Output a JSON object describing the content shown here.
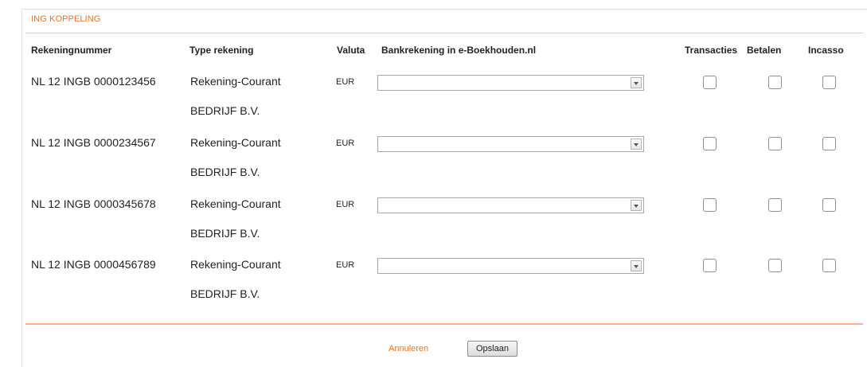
{
  "panel": {
    "title": "ING KOPPELING"
  },
  "columns": {
    "account_number": "Rekeningnummer",
    "account_type": "Type rekening",
    "currency": "Valuta",
    "bookkeeping_account": "Bankrekening in e-Boekhouden.nl",
    "transactions": "Transacties",
    "payments": "Betalen",
    "collection": "Incasso"
  },
  "rows": [
    {
      "account_number": "NL 12 INGB 0000123456",
      "account_type": "Rekening-Courant",
      "account_holder": "BEDRIJF B.V.",
      "currency": "EUR",
      "bookkeeping_account": "",
      "transactions": false,
      "payments": false,
      "collection": false
    },
    {
      "account_number": "NL 12 INGB 0000234567",
      "account_type": "Rekening-Courant",
      "account_holder": "BEDRIJF B.V.",
      "currency": "EUR",
      "bookkeeping_account": "",
      "transactions": false,
      "payments": false,
      "collection": false
    },
    {
      "account_number": "NL 12 INGB 0000345678",
      "account_type": "Rekening-Courant",
      "account_holder": "BEDRIJF B.V.",
      "currency": "EUR",
      "bookkeeping_account": "",
      "transactions": false,
      "payments": false,
      "collection": false
    },
    {
      "account_number": "NL 12 INGB 0000456789",
      "account_type": "Rekening-Courant",
      "account_holder": "BEDRIJF B.V.",
      "currency": "EUR",
      "bookkeeping_account": "",
      "transactions": false,
      "payments": false,
      "collection": false
    }
  ],
  "footer": {
    "cancel_label": "Annuleren",
    "save_label": "Opslaan"
  },
  "colors": {
    "accent": "#e8742a",
    "rule": "#f4b38a"
  }
}
